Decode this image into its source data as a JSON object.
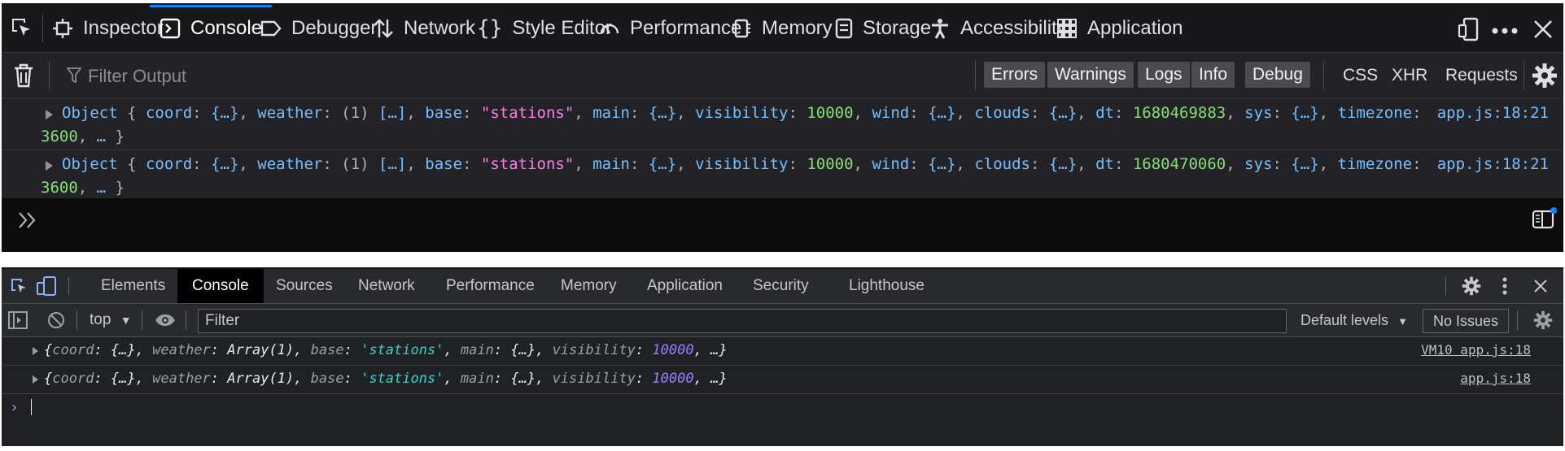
{
  "firefox": {
    "tabs": [
      {
        "label": "Inspector",
        "icon": "inspector-icon"
      },
      {
        "label": "Console",
        "icon": "console-icon",
        "selected": true
      },
      {
        "label": "Debugger",
        "icon": "debugger-icon"
      },
      {
        "label": "Network",
        "icon": "network-icon"
      },
      {
        "label": "Style Editor",
        "icon": "style-editor-icon"
      },
      {
        "label": "Performance",
        "icon": "performance-icon"
      },
      {
        "label": "Memory",
        "icon": "memory-icon"
      },
      {
        "label": "Storage",
        "icon": "storage-icon"
      },
      {
        "label": "Accessibility",
        "icon": "accessibility-icon"
      },
      {
        "label": "Application",
        "icon": "application-icon"
      }
    ],
    "filter_placeholder": "Filter Output",
    "levels": [
      "Errors",
      "Warnings",
      "Logs",
      "Info",
      "Debug"
    ],
    "net_filters": [
      "CSS",
      "XHR",
      "Requests"
    ],
    "messages": [
      {
        "prefix": "Object",
        "dt": "1680469883",
        "source": "app.js:18:21"
      },
      {
        "prefix": "Object",
        "dt": "1680470060",
        "source": "app.js:18:21"
      }
    ],
    "msg_tokens": {
      "coord": "coord",
      "weather": "weather",
      "weather_len": "(1)",
      "base": "base",
      "base_val": "\"stations\"",
      "main": "main",
      "visibility": "visibility",
      "visibility_val": "10000",
      "wind": "wind",
      "clouds": "clouds",
      "dt": "dt",
      "sys": "sys",
      "timezone": "timezone",
      "timezone_val": "3600",
      "obj": "{…}",
      "arr": "[…]",
      "ellipsis": "…"
    }
  },
  "chrome": {
    "tabs": [
      {
        "label": "Elements"
      },
      {
        "label": "Console",
        "selected": true
      },
      {
        "label": "Sources"
      },
      {
        "label": "Network"
      },
      {
        "label": "Performance"
      },
      {
        "label": "Memory"
      },
      {
        "label": "Application"
      },
      {
        "label": "Security"
      },
      {
        "label": "Lighthouse"
      }
    ],
    "context": "top",
    "filter_placeholder": "Filter",
    "default_levels": "Default levels",
    "issues": "No Issues",
    "messages": [
      {
        "source": "VM10 app.js:18"
      },
      {
        "source": "app.js:18"
      }
    ],
    "msg_tokens": {
      "coord": "coord",
      "weather": "weather",
      "weather_val": "Array(1)",
      "base": "base",
      "base_val": "'stations'",
      "main": "main",
      "visibility": "visibility",
      "visibility_val": "10000",
      "obj": "{…}",
      "ellipsis": "…"
    }
  }
}
